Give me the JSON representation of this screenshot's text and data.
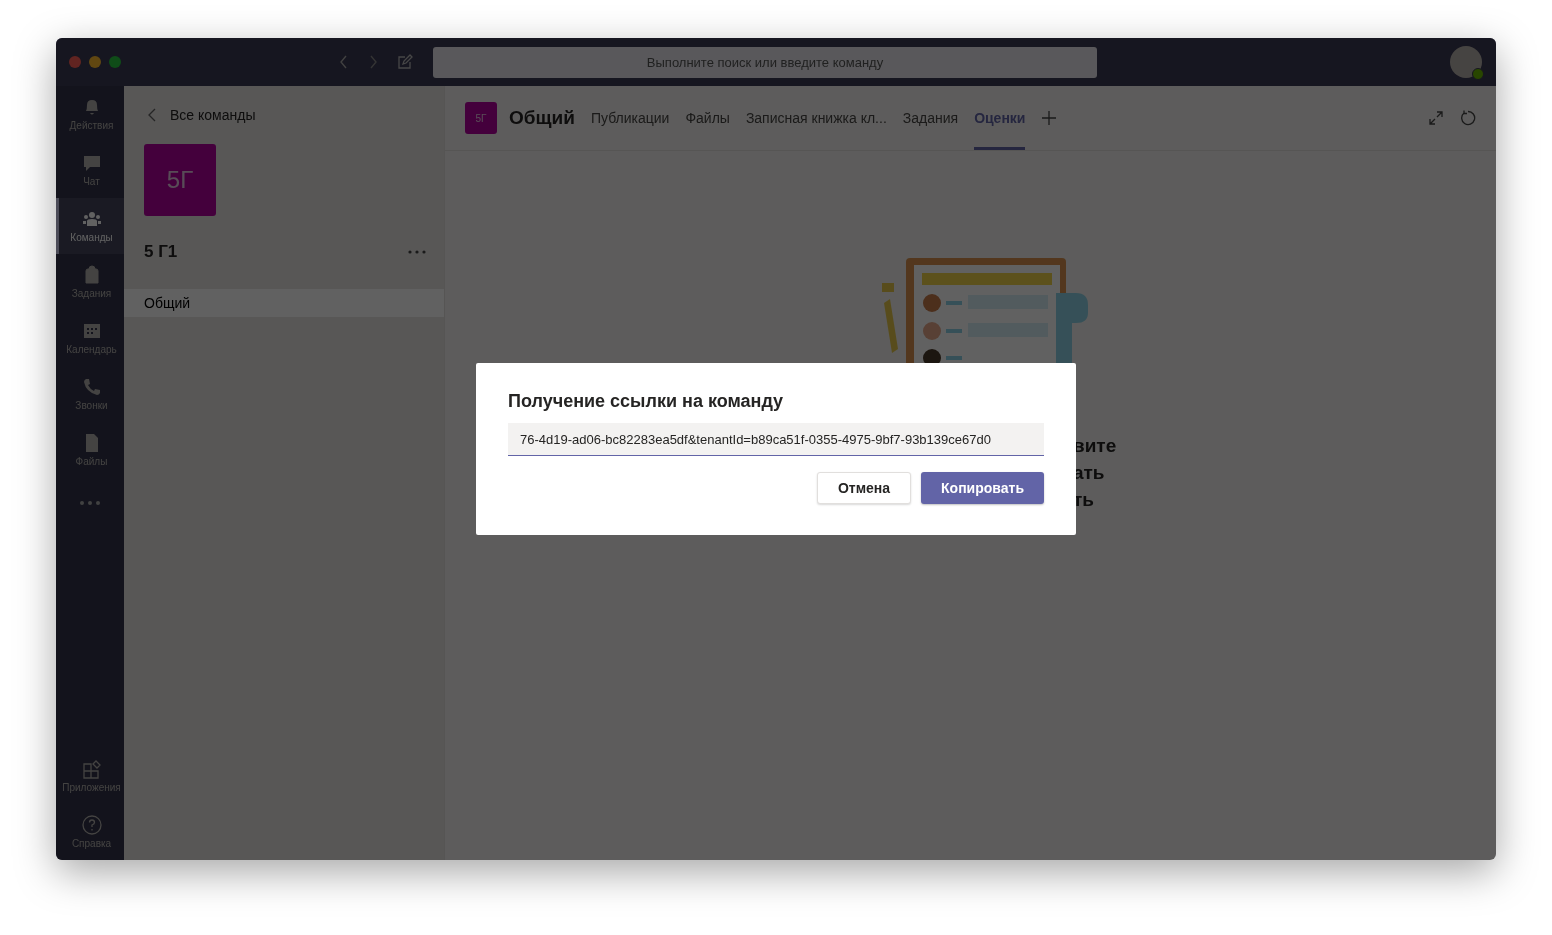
{
  "search": {
    "placeholder": "Выполните поиск или введите команду"
  },
  "rail": {
    "items": [
      {
        "label": "Действия",
        "kind": "bell",
        "selected": false
      },
      {
        "label": "Чат",
        "kind": "chat",
        "selected": false
      },
      {
        "label": "Команды",
        "kind": "teams",
        "selected": true
      },
      {
        "label": "Задания",
        "kind": "bag",
        "selected": false
      },
      {
        "label": "Календарь",
        "kind": "calendar",
        "selected": false
      },
      {
        "label": "Звонки",
        "kind": "phone",
        "selected": false
      },
      {
        "label": "Файлы",
        "kind": "file",
        "selected": false
      }
    ],
    "bottom_items": [
      {
        "label": "Приложения",
        "kind": "apps",
        "selected": false
      },
      {
        "label": "Справка",
        "kind": "help",
        "selected": false
      }
    ]
  },
  "team_panel": {
    "back_label": "Все команды",
    "tile": "5Г",
    "team_name": "5 Г1",
    "channels": [
      {
        "label": "Общий",
        "selected": true
      }
    ]
  },
  "channel_header": {
    "tile": "5Г",
    "name": "Общий",
    "tabs": [
      {
        "label": "Публикации",
        "selected": false
      },
      {
        "label": "Файлы",
        "selected": false
      },
      {
        "label": "Записная книжка кл...",
        "selected": false
      },
      {
        "label": "Задания",
        "selected": false
      },
      {
        "label": "Оценки",
        "selected": true
      }
    ]
  },
  "behind_text": [
    "вите",
    "ать",
    "ть"
  ],
  "dialog": {
    "title": "Получение ссылки на команду",
    "link_value": "76-4d19-ad06-bc82283ea5df&tenantId=b89ca51f-0355-4975-9bf7-93b139ce67d0",
    "buttons": [
      {
        "label": "Отмена",
        "kind": "secondary"
      },
      {
        "label": "Копировать",
        "kind": "primary"
      }
    ]
  }
}
